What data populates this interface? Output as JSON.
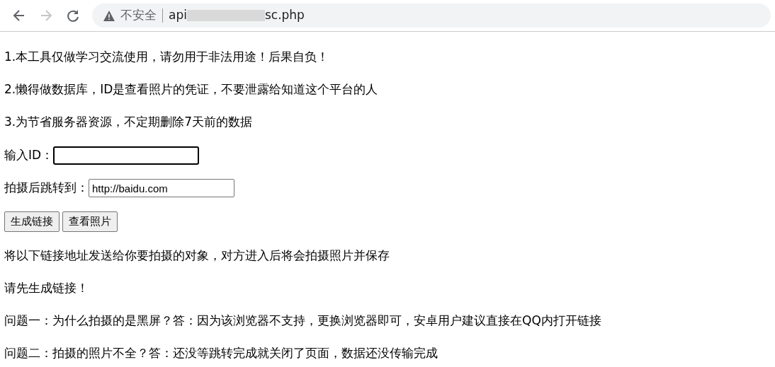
{
  "browser": {
    "security_label": "不安全",
    "url_start": "api",
    "url_redacted": true,
    "url_end": "sc.php"
  },
  "notes": [
    "1.本工具仅做学习交流使用，请勿用于非法用途！后果自负！",
    "2.懒得做数据库，ID是查看照片的凭证，不要泄露给知道这个平台的人",
    "3.为节省服务器资源，不定期删除7天前的数据"
  ],
  "form": {
    "id_label": "输入ID：",
    "id_focused": true,
    "redirect_label": "拍摄后跳转到：",
    "redirect_value": "http://baidu.com"
  },
  "buttons": [
    "生成链接",
    "查看照片"
  ],
  "messages": [
    "将以下链接地址发送给你要拍摄的对象，对方进入后将会拍摄照片并保存",
    "请先生成链接！",
    "问题一：为什么拍摄的是黑屏？答：因为该浏览器不支持，更换浏览器即可，安卓用户建议直接在QQ内打开链接",
    "问题二：拍摄的照片不全？答：还没等跳转完成就关闭了页面，数据还没传输完成"
  ]
}
